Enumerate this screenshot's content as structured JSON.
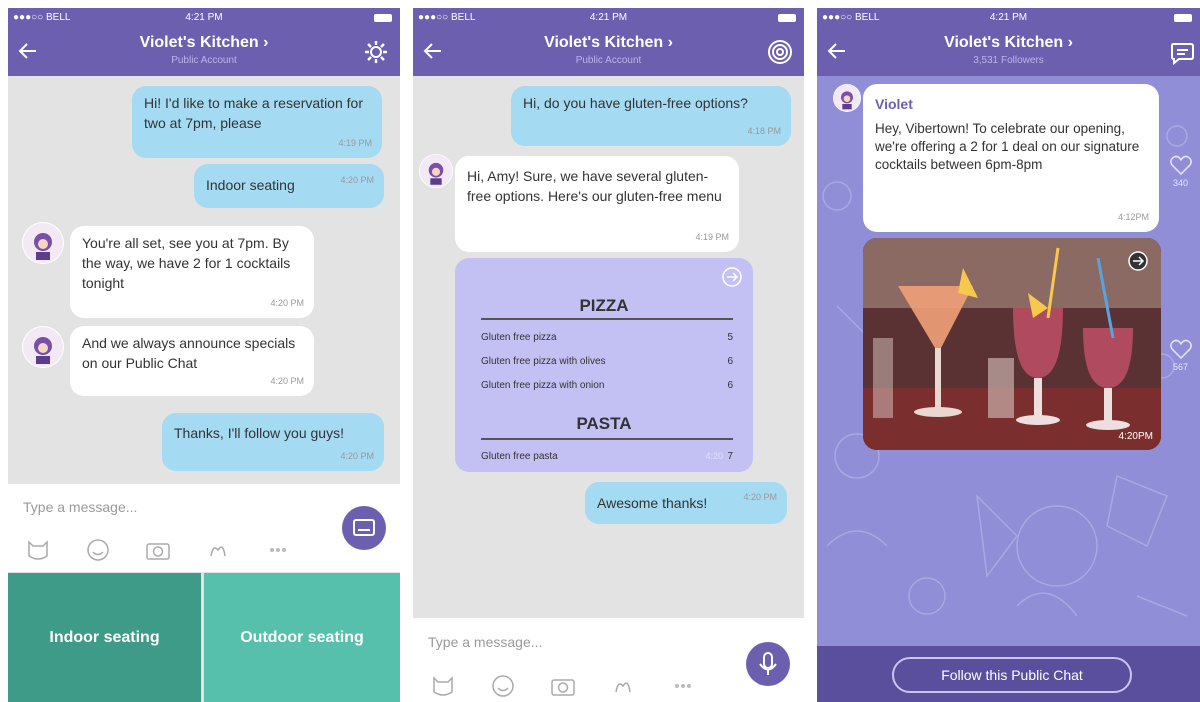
{
  "status": {
    "carrier": "●●●○○ BELL",
    "time": "4:21 PM"
  },
  "screen1": {
    "title": "Violet's Kitchen ›",
    "subtitle": "Public Account",
    "messages": [
      {
        "text": "Hi! I'd like to make a reservation for two at 7pm, please",
        "time": "4:19 PM"
      },
      {
        "text": "Indoor seating",
        "time": "4:20 PM"
      },
      {
        "text": "You're all set, see you at 7pm. By the way, we have 2 for 1 cocktails tonight",
        "time": "4:20 PM"
      },
      {
        "text": "And we always announce specials on our Public Chat",
        "time": "4:20 PM"
      },
      {
        "text": "Thanks, I'll follow you guys!",
        "time": "4:20 PM"
      }
    ],
    "input_placeholder": "Type a message...",
    "quick_replies": [
      "Indoor seating",
      "Outdoor seating"
    ]
  },
  "screen2": {
    "title": "Violet's Kitchen ›",
    "subtitle": "Public Account",
    "messages": [
      {
        "text": "Hi, do you have gluten-free options?",
        "time": "4:18 PM"
      },
      {
        "text": "Hi, Amy! Sure, we have several gluten-free options. Here's our gluten-free menu",
        "time": "4:19 PM"
      },
      {
        "text": "Awesome thanks!",
        "time": "4:20 PM"
      }
    ],
    "menu": {
      "section1": "PIZZA",
      "items1": [
        {
          "name": "Gluten free pizza",
          "price": "5"
        },
        {
          "name": "Gluten free pizza with olives",
          "price": "6"
        },
        {
          "name": "Gluten free pizza with onion",
          "price": "6"
        }
      ],
      "section2": "PASTA",
      "items2": [
        {
          "name": "Gluten free pasta",
          "price": "7"
        }
      ],
      "time": "4:20"
    },
    "input_placeholder": "Type a message..."
  },
  "screen3": {
    "title": "Violet's Kitchen ›",
    "subtitle": "3,531 Followers",
    "sender": "Violet",
    "post_text": "Hey, Vibertown! To celebrate our opening, we're offering a 2 for 1 deal on our signature cocktails between 6pm-8pm",
    "post_time": "4:12PM",
    "photo_time": "4:20PM",
    "likes": [
      "340",
      "567"
    ],
    "follow_label": "Follow this Public Chat"
  },
  "colors": {
    "brand": "#6c5fb0",
    "out_bubble": "#a4daf2",
    "quick1": "#3e9b87",
    "quick2": "#56c0ac"
  }
}
